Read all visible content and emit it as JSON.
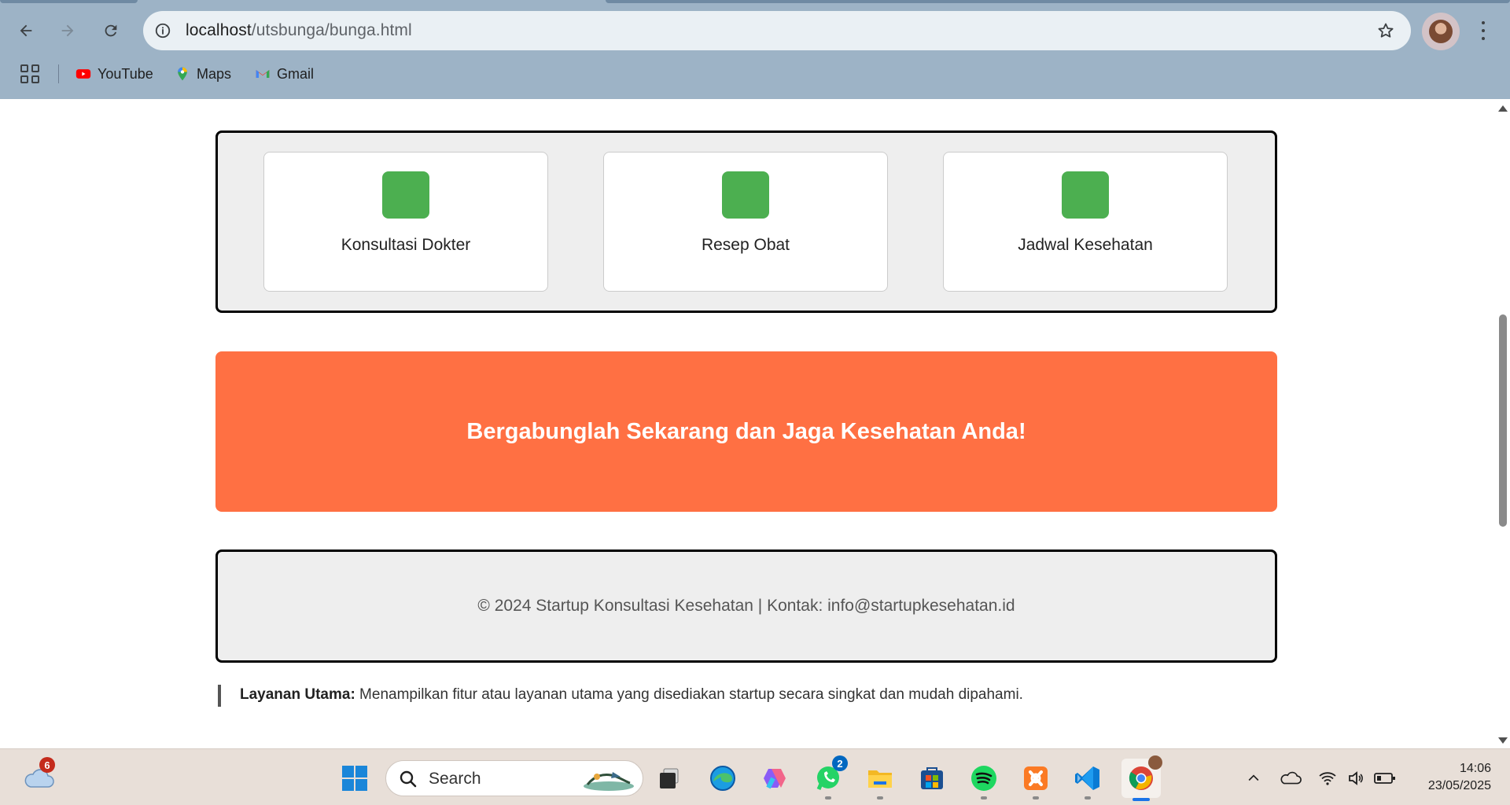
{
  "browser": {
    "url_host": "localhost",
    "url_path": "/utsbunga/bunga.html",
    "bookmarks": [
      {
        "label": "YouTube",
        "icon": "youtube-icon"
      },
      {
        "label": "Maps",
        "icon": "maps-icon"
      },
      {
        "label": "Gmail",
        "icon": "gmail-icon"
      }
    ]
  },
  "features": {
    "items": [
      {
        "label": "Konsultasi Dokter"
      },
      {
        "label": "Resep Obat"
      },
      {
        "label": "Jadwal Kesehatan"
      }
    ],
    "icon_color": "#4caf50"
  },
  "cta": {
    "text": "Bergabunglah Sekarang dan Jaga Kesehatan Anda!",
    "color": "#ff7043"
  },
  "footer": {
    "text": "© 2024 Startup Konsultasi Kesehatan | Kontak: info@startupkesehatan.id"
  },
  "note": {
    "title": "Layanan Utama:",
    "body": " Menampilkan fitur atau layanan utama yang disediakan startup secara singkat dan mudah dipahami."
  },
  "taskbar": {
    "weather_badge": "6",
    "search_placeholder": "Search",
    "whatsapp_badge": "2",
    "time": "14:06",
    "date": "23/05/2025"
  }
}
